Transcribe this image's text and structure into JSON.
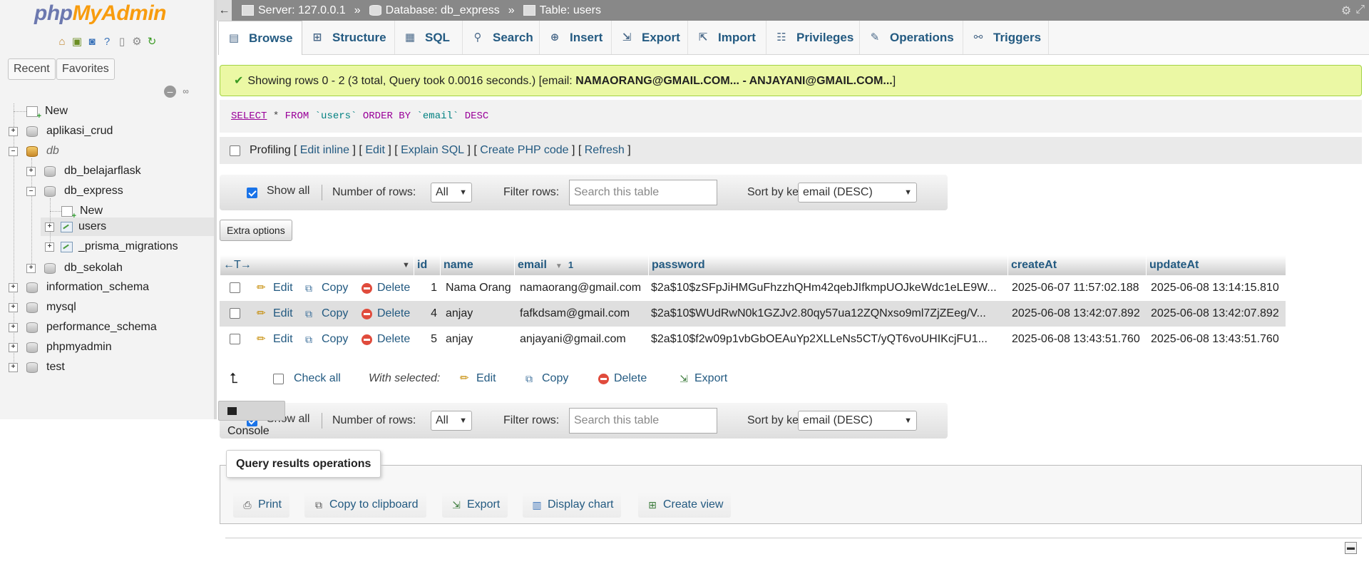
{
  "logo": {
    "php": "php",
    "myadmin": "MyAdmin"
  },
  "nav": {
    "icons": [
      "home-icon",
      "database-icon",
      "query-icon",
      "help-icon",
      "docs-icon",
      "settings-icon",
      "reload-icon"
    ],
    "tabs": [
      "Recent",
      "Favorites"
    ],
    "tree": {
      "new": "New",
      "aplikasi_crud": "aplikasi_crud",
      "db": "db",
      "db_belajarflask": "db_belajarflask",
      "db_express": "db_express",
      "db_express_new": "New",
      "users": "users",
      "prisma": "_prisma_migrations",
      "db_sekolah": "db_sekolah",
      "information_schema": "information_schema",
      "mysql": "mysql",
      "performance_schema": "performance_schema",
      "phpmyadmin": "phpmyadmin",
      "test": "test"
    }
  },
  "breadcrumb": {
    "server": "Server: 127.0.0.1",
    "database": "Database: db_express",
    "table": "Table: users",
    "sep": "»"
  },
  "tabs": [
    "Browse",
    "Structure",
    "SQL",
    "Search",
    "Insert",
    "Export",
    "Import",
    "Privileges",
    "Operations",
    "Triggers"
  ],
  "message": {
    "text": "Showing rows 0 - 2 (3 total, Query took 0.0016 seconds.) [email: ",
    "range": "NAMAORANG@GMAIL.COM... - ANJAYANI@GMAIL.COM...",
    "close": "]"
  },
  "sql": {
    "select": "SELECT",
    "star": " * ",
    "from": "FROM",
    "table": " `users` ",
    "orderby": "ORDER BY",
    "col": " `email` ",
    "desc": "DESC"
  },
  "profiling": {
    "label": "Profiling",
    "links": [
      "Edit inline",
      "Edit",
      "Explain SQL",
      "Create PHP code",
      "Refresh"
    ]
  },
  "table_nav": {
    "show_all": "Show all",
    "rows_label": "Number of rows:",
    "rows_value": "All",
    "filter_label": "Filter rows:",
    "filter_placeholder": "Search this table",
    "sort_label": "Sort by key:",
    "sort_value": "email (DESC)"
  },
  "extra_options": "Extra options",
  "columns": {
    "arrows": "←T→",
    "id": "id",
    "name": "name",
    "email": "email",
    "email_sort": "1",
    "password": "password",
    "createAt": "createAt",
    "updateAt": "updateAt"
  },
  "row_actions": {
    "edit": "Edit",
    "copy": "Copy",
    "delete": "Delete"
  },
  "rows": [
    {
      "id": "1",
      "name": "Nama Orang",
      "email": "namaorang@gmail.com",
      "password": "$2a$10$zSFpJiHMGuFhzzhQHm42qebJIfkmpUOJkeWdc1eLE9W...",
      "createAt": "2025-06-07 11:57:02.188",
      "updateAt": "2025-06-08 13:14:15.810"
    },
    {
      "id": "4",
      "name": "anjay",
      "email": "fafkdsam@gmail.com",
      "password": "$2a$10$WUdRwN0k1GZJv2.80qy57ua12ZQNxso9ml7ZjZEeg/V...",
      "createAt": "2025-06-08 13:42:07.892",
      "updateAt": "2025-06-08 13:42:07.892"
    },
    {
      "id": "5",
      "name": "anjay",
      "email": "anjayani@gmail.com",
      "password": "$2a$10$f2w09p1vbGbOEAuYp2XLLeNs5CT/yQT6voUHIKcjFU1...",
      "createAt": "2025-06-08 13:43:51.760",
      "updateAt": "2025-06-08 13:43:51.760"
    }
  ],
  "with_selected": {
    "check_all": "Check all",
    "label": "With selected:",
    "edit": "Edit",
    "copy": "Copy",
    "delete": "Delete",
    "export": "Export"
  },
  "console": "Console",
  "query_ops": {
    "legend": "Query results operations",
    "buttons": [
      "Print",
      "Copy to clipboard",
      "Export",
      "Display chart",
      "Create view"
    ]
  }
}
